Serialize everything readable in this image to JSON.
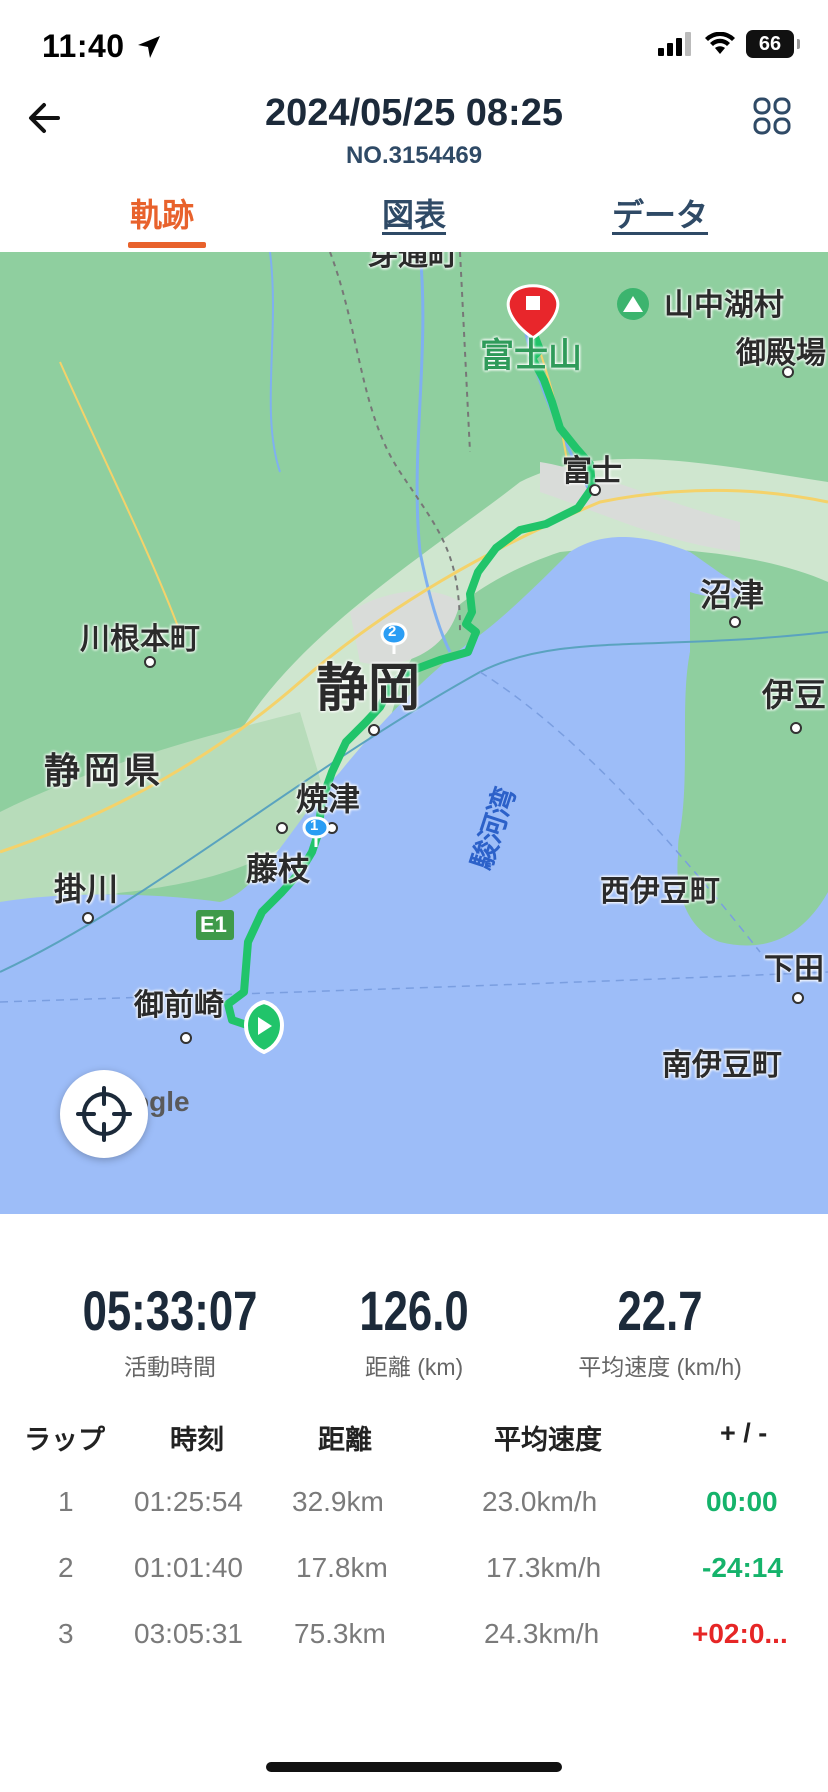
{
  "status_bar": {
    "time": "11:40",
    "battery": "66"
  },
  "header": {
    "title": "2024/05/25 08:25",
    "subtitle": "NO.3154469"
  },
  "tabs": [
    {
      "label": "軌跡",
      "active": true
    },
    {
      "label": "図表",
      "active": false
    },
    {
      "label": "データ",
      "active": false
    }
  ],
  "map": {
    "labels": {
      "top_town": "芽通町",
      "yamanakako": "山中湖村",
      "fujisan": "富士山",
      "gotemba": "御殿場",
      "fuji": "富士",
      "numazu": "沼津",
      "kawanehon": "川根本町",
      "shizuoka": "静岡",
      "izu": "伊豆",
      "shizuoka_pref": "静岡県",
      "yaizu": "焼津",
      "fujieda": "藤枝",
      "suruga_bay": "駿河湾",
      "kakegawa": "掛川",
      "nishiizu": "西伊豆町",
      "shimoda": "下田",
      "omaezaki": "御前崎",
      "minamiizu": "南伊豆町",
      "expressway": "E1"
    },
    "markers": {
      "lap1": "1",
      "lap2": "2"
    },
    "google": "ogle"
  },
  "stats": [
    {
      "value": "05:33:07",
      "label": "活動時間"
    },
    {
      "value": "126.0",
      "label": "距離 (km)"
    },
    {
      "value": "22.7",
      "label": "平均速度 (km/h)"
    }
  ],
  "laps": {
    "headers": [
      "ラップ",
      "時刻",
      "距離",
      "平均速度",
      "+ / -"
    ],
    "rows": [
      {
        "lap": "1",
        "time": "01:25:54",
        "distance": "32.9km",
        "speed": "23.0km/h",
        "diff": "00:00",
        "diff_color": "green"
      },
      {
        "lap": "2",
        "time": "01:01:40",
        "distance": "17.8km",
        "speed": "17.3km/h",
        "diff": "-24:14",
        "diff_color": "green"
      },
      {
        "lap": "3",
        "time": "03:05:31",
        "distance": "75.3km",
        "speed": "24.3km/h",
        "diff": "+02:0...",
        "diff_color": "red"
      }
    ]
  }
}
